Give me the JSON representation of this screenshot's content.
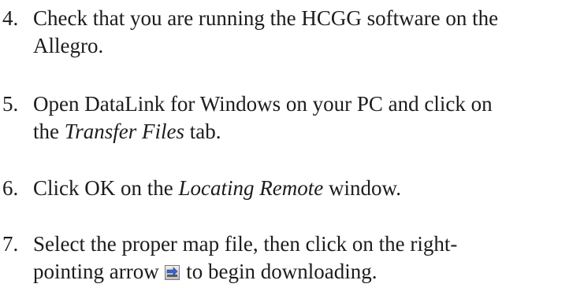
{
  "steps": [
    {
      "number": "4.",
      "line1": "Check that you are running the HCGG software on the",
      "line2": "Allegro."
    },
    {
      "number": "5.",
      "line1": "Open DataLink for Windows on your PC and click on",
      "line2_pre": "the ",
      "line2_em": "Transfer Files",
      "line2_post": " tab."
    },
    {
      "number": "6.",
      "line1_pre": "Click OK on the ",
      "line1_em": "Locating Remote",
      "line1_post": " window."
    },
    {
      "number": "7.",
      "line1": "Select the proper map file, then click on the right-",
      "line2_pre": "pointing arrow ",
      "line2_icon": "right-arrow-download-icon",
      "line2_post": " to begin downloading."
    }
  ]
}
